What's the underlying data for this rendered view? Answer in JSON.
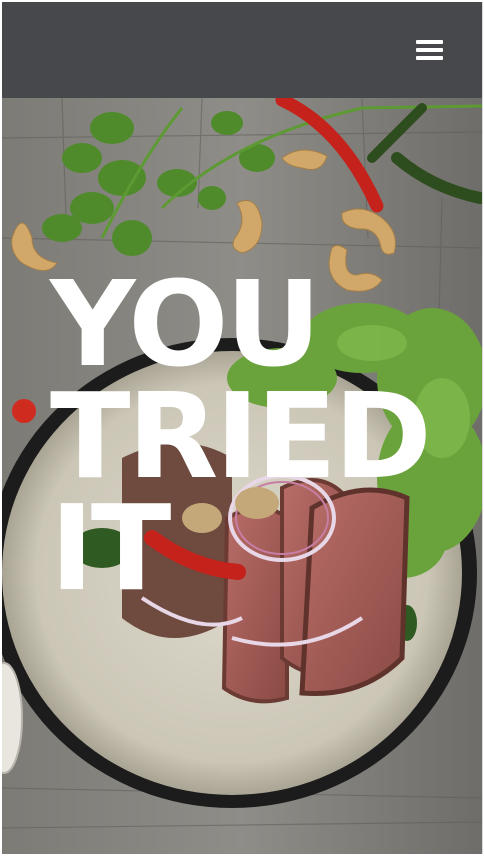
{
  "header": {
    "menu_icon": "hamburger-menu-icon",
    "background": "#47484c"
  },
  "hero": {
    "headline_lines": [
      "YOU",
      "TRIED",
      "IT"
    ],
    "image": "food-photo-steak-salad",
    "headline_color": "#ffffff"
  }
}
